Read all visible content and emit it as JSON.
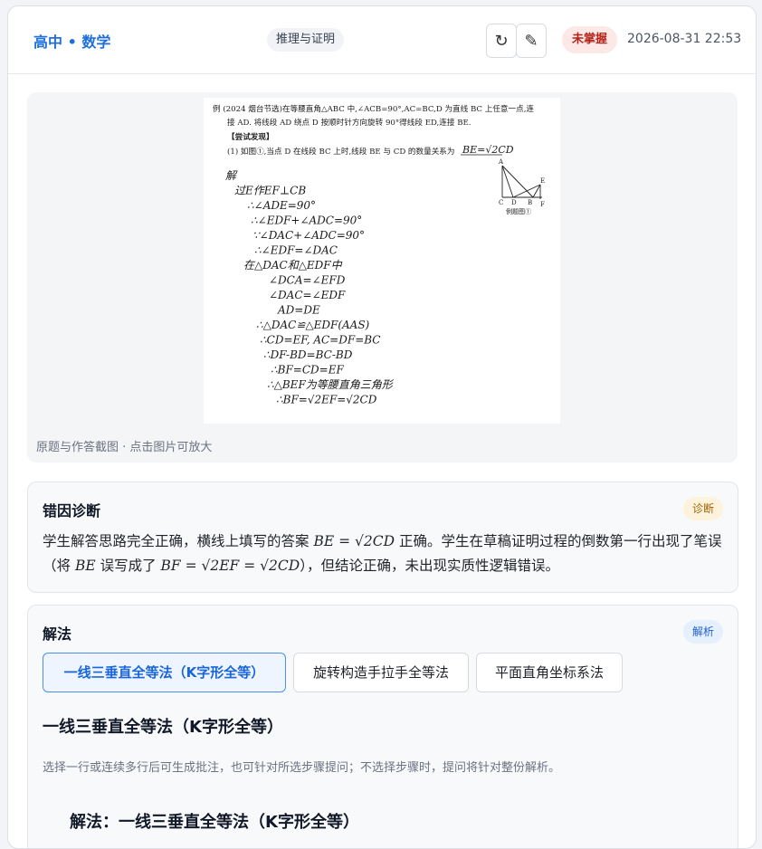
{
  "header": {
    "subject": "高中 • 数学",
    "topic_tag": "推理与证明",
    "refresh_icon": "↻",
    "edit_icon": "✎",
    "status": "未掌握",
    "timestamp": "2026-08-31 22:53"
  },
  "image": {
    "caption": "原题与作答截图 · 点击图片可放大",
    "problem_line1": "例  (2024 烟台节选)在等腰直角△ABC 中,∠ACB=90°,AC=BC,D 为直线 BC 上任意一点,连",
    "problem_line2": "接 AD. 将线段 AD 绕点 D 按顺时针方向旋转 90°得线段 ED,连接 BE.",
    "problem_line3": "【尝试发现】",
    "problem_line4": "(1) 如图①,当点 D 在线段 BC 上时,线段 BE 与 CD 的数量关系为",
    "answer_handwritten": "BE=√2CD",
    "figure_caption": "例题图①",
    "handwriting": [
      "解",
      "过E作EF⊥CB",
      "∴∠ADE=90°",
      "∴∠EDF+∠ADC=90°",
      "∵∠DAC+∠ADC=90°",
      "∴∠EDF=∠DAC",
      "在△DAC和△EDF中",
      "∠DCA=∠EFD",
      "∠DAC=∠EDF",
      "AD=DE",
      "∴△DAC≌△EDF(AAS)",
      "∴CD=EF, AC=DF=BC",
      "∴DF-BD=BC-BD",
      "∴BF=CD=EF",
      "∴△BEF为等腰直角三角形",
      "∴BF=√2EF=√2CD"
    ]
  },
  "diagnosis": {
    "title": "错因诊断",
    "badge": "诊断",
    "text_1": "学生解答思路完全正确，横线上填写的答案 ",
    "math_1": "BE = √2CD",
    "text_2": " 正确。学生在草稿证明过程的倒数第一行出现了笔误（将 ",
    "math_2": "BE",
    "text_3": " 误写成了 ",
    "math_3": "BF = √2EF = √2CD",
    "text_4": "），但结论正确，未出现实质性逻辑错误。"
  },
  "solution": {
    "title": "解法",
    "badge": "解析",
    "tabs": [
      {
        "label": "一线三垂直全等法（K字形全等）"
      },
      {
        "label": "旋转构造手拉手全等法"
      },
      {
        "label": "平面直角坐标系法"
      }
    ],
    "active_method_title": "一线三垂直全等法（K字形全等）",
    "hint": "选择一行或连续多行后可生成批注，也可针对所选步骤提问；不选择步骤时，提问将针对整份解析。",
    "content_heading": "解法：一线三垂直全等法（K字形全等）"
  }
}
